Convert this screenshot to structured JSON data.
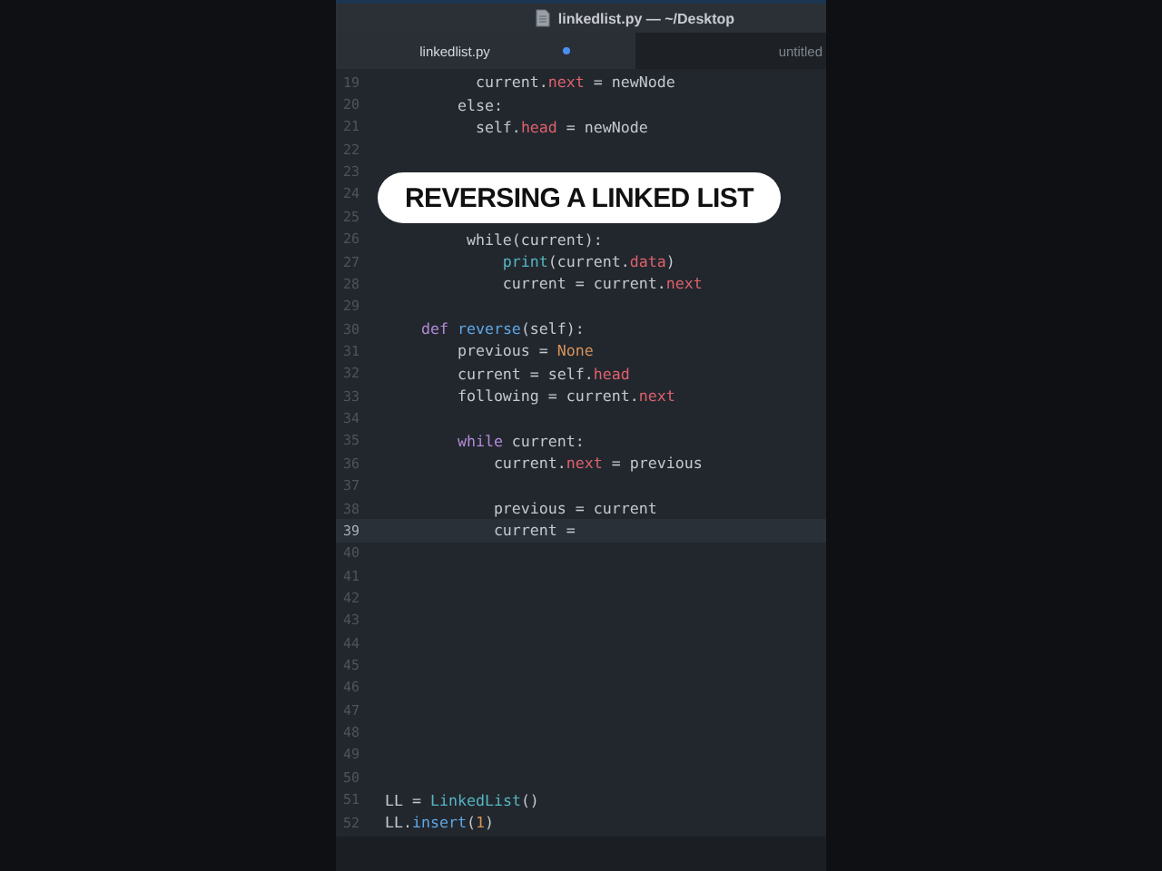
{
  "window": {
    "title": "linkedlist.py — ~/Desktop"
  },
  "tabs": [
    {
      "label": "linkedlist.py",
      "selected": true,
      "modified": true
    },
    {
      "label": "untitled",
      "selected": false,
      "modified": false
    }
  ],
  "editor": {
    "lines": [
      {
        "number": "19",
        "current": false,
        "tokens": [
          {
            "text": "          current.",
            "kind": "plain"
          },
          {
            "text": "next",
            "kind": "attr"
          },
          {
            "text": " = newNode",
            "kind": "plain"
          }
        ]
      },
      {
        "number": "20",
        "current": false,
        "tokens": [
          {
            "text": "        else:",
            "kind": "plain"
          }
        ]
      },
      {
        "number": "21",
        "current": false,
        "tokens": [
          {
            "text": "          self.",
            "kind": "plain"
          },
          {
            "text": "head",
            "kind": "attr"
          },
          {
            "text": " = newNode",
            "kind": "plain"
          }
        ]
      },
      {
        "number": "22",
        "current": false
      },
      {
        "number": "23",
        "current": false
      },
      {
        "number": "24",
        "current": false
      },
      {
        "number": "25",
        "current": false
      },
      {
        "number": "26",
        "current": false,
        "tokens": [
          {
            "text": "         while(current):",
            "kind": "plain"
          }
        ]
      },
      {
        "number": "27",
        "current": false,
        "tokens": [
          {
            "text": "             print",
            "kind": "builtin"
          },
          {
            "text": "(current.",
            "kind": "plain"
          },
          {
            "text": "data",
            "kind": "attr"
          },
          {
            "text": ")",
            "kind": "plain"
          }
        ]
      },
      {
        "number": "28",
        "current": false,
        "tokens": [
          {
            "text": "             current = current.",
            "kind": "plain"
          },
          {
            "text": "next",
            "kind": "attr"
          }
        ]
      },
      {
        "number": "29",
        "current": false
      },
      {
        "number": "30",
        "current": false,
        "tokens": [
          {
            "text": "    def",
            "kind": "keyword"
          },
          {
            "text": " reverse",
            "kind": "func"
          },
          {
            "text": "(self):",
            "kind": "plain"
          }
        ]
      },
      {
        "number": "31",
        "current": false,
        "tokens": [
          {
            "text": "        previous = ",
            "kind": "plain"
          },
          {
            "text": "None",
            "kind": "const"
          }
        ]
      },
      {
        "number": "32",
        "current": false,
        "tokens": [
          {
            "text": "        current = self.",
            "kind": "plain"
          },
          {
            "text": "head",
            "kind": "attr"
          }
        ]
      },
      {
        "number": "33",
        "current": false,
        "tokens": [
          {
            "text": "        following = current.",
            "kind": "plain"
          },
          {
            "text": "next",
            "kind": "attr"
          }
        ]
      },
      {
        "number": "34",
        "current": false
      },
      {
        "number": "35",
        "current": false,
        "tokens": [
          {
            "text": "        while",
            "kind": "keyword"
          },
          {
            "text": " current:",
            "kind": "plain"
          }
        ]
      },
      {
        "number": "36",
        "current": false,
        "tokens": [
          {
            "text": "            current.",
            "kind": "plain"
          },
          {
            "text": "next",
            "kind": "attr"
          },
          {
            "text": " = previous",
            "kind": "plain"
          }
        ]
      },
      {
        "number": "37",
        "current": false
      },
      {
        "number": "38",
        "current": false,
        "tokens": [
          {
            "text": "            previous = current",
            "kind": "plain"
          }
        ]
      },
      {
        "number": "39",
        "current": true,
        "tokens": [
          {
            "text": "            current =",
            "kind": "plain"
          }
        ]
      },
      {
        "number": "40",
        "current": false
      },
      {
        "number": "41",
        "current": false
      },
      {
        "number": "42",
        "current": false
      },
      {
        "number": "43",
        "current": false
      },
      {
        "number": "44",
        "current": false
      },
      {
        "number": "45",
        "current": false
      },
      {
        "number": "46",
        "current": false
      },
      {
        "number": "47",
        "current": false
      },
      {
        "number": "48",
        "current": false
      },
      {
        "number": "49",
        "current": false
      },
      {
        "number": "50",
        "current": false
      },
      {
        "number": "51",
        "current": false,
        "tokens": [
          {
            "text": "LL = ",
            "kind": "plain"
          },
          {
            "text": "LinkedList",
            "kind": "builtin"
          },
          {
            "text": "()",
            "kind": "plain"
          }
        ]
      },
      {
        "number": "52",
        "current": false,
        "tokens": [
          {
            "text": "LL.",
            "kind": "plain"
          },
          {
            "text": "insert",
            "kind": "func"
          },
          {
            "text": "(",
            "kind": "plain"
          },
          {
            "text": "1",
            "kind": "const"
          },
          {
            "text": ")",
            "kind": "plain"
          }
        ]
      }
    ]
  },
  "caption": "REVERSING A LINKED LIST"
}
